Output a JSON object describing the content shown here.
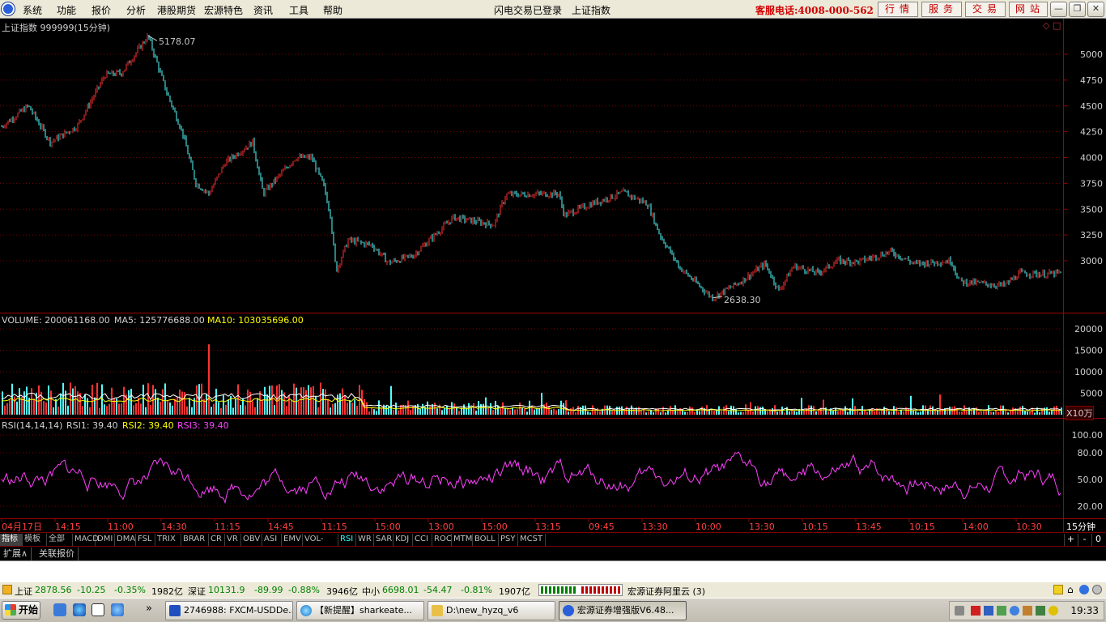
{
  "menubar": {
    "items": [
      "系统",
      "功能",
      "报价",
      "分析",
      "港股期货",
      "宏源特色",
      "资讯",
      "工具",
      "帮助"
    ],
    "status_login": "闪电交易已登录",
    "current_index": "上证指数",
    "hotline": "客服电话:4008-000-562",
    "right_buttons": [
      "行情",
      "服务",
      "交易",
      "网站"
    ],
    "window_controls": [
      "minimize",
      "restore",
      "close"
    ]
  },
  "main_chart": {
    "title": "上证指数 999999(15分钟)",
    "max_label": "5178.07",
    "min_label": "2638.30",
    "y_ticks": [
      5000,
      4750,
      4500,
      4250,
      4000,
      3750,
      3500,
      3250,
      3000
    ],
    "up_color": "#ff3232",
    "down_color": "#54ffff"
  },
  "volume": {
    "label": "VOLUME: 200061168.00",
    "ma5": "MA5: 125776688.00",
    "ma10": "MA10: 103035696.00",
    "y_ticks": [
      "20000",
      "15000",
      "10000",
      "5000"
    ],
    "unit": "X10万"
  },
  "rsi": {
    "label": "RSI(14,14,14)",
    "rsi1": "RSI1: 39.40",
    "rsi2": "RSI2: 39.40",
    "rsi3": "RSI3: 39.40",
    "y_ticks": [
      "100.00",
      "80.00",
      "50.00",
      "20.00"
    ]
  },
  "time_axis": {
    "labels": [
      "04月17日",
      "14:15",
      "11:00",
      "14:30",
      "11:15",
      "14:45",
      "11:15",
      "15:00",
      "13:00",
      "15:00",
      "13:15",
      "09:45",
      "13:30",
      "10:00",
      "13:30",
      "10:15",
      "13:45",
      "10:15",
      "14:00",
      "10:30"
    ],
    "period": "15分钟"
  },
  "indicator_tabs": {
    "items": [
      "指标",
      "模板",
      "全部",
      "MACD",
      "DMI",
      "DMA",
      "FSL",
      "TRIX",
      "BRAR",
      "CR",
      "VR",
      "OBV",
      "ASI",
      "EMV",
      "VOL-TDX",
      "RSI",
      "WR",
      "SAR",
      "KDJ",
      "CCI",
      "ROC",
      "MTM",
      "BOLL",
      "PSY",
      "MCST"
    ],
    "controls": [
      "+",
      "-",
      "0"
    ]
  },
  "ext_tabs": [
    "扩展∧",
    "关联报价"
  ],
  "statusbar": {
    "sh_name": "上证",
    "sh_val": "2878.56",
    "sh_chg": "-10.25",
    "sh_pct": "-0.35%",
    "sh_amt": "1982亿",
    "sz_name": "深证",
    "sz_val": "10131.9",
    "sz_chg": "-89.99",
    "sz_pct": "-0.88%",
    "sz_amt": "3946亿",
    "zx_name": "中小",
    "zx_val": "6698.01",
    "zx_chg": "-54.47",
    "zx_pct": "-0.81%",
    "zx_amt": "1907亿",
    "server": "宏源证券阿里云 (3)"
  },
  "taskbar": {
    "start": "开始",
    "tasks": [
      "2746988: FXCM-USDDe...",
      "【新提醒】sharkeate...",
      "D:\\new_hyzq_v6",
      "宏源证券增强版V6.48..."
    ],
    "clock": "19:33"
  }
}
